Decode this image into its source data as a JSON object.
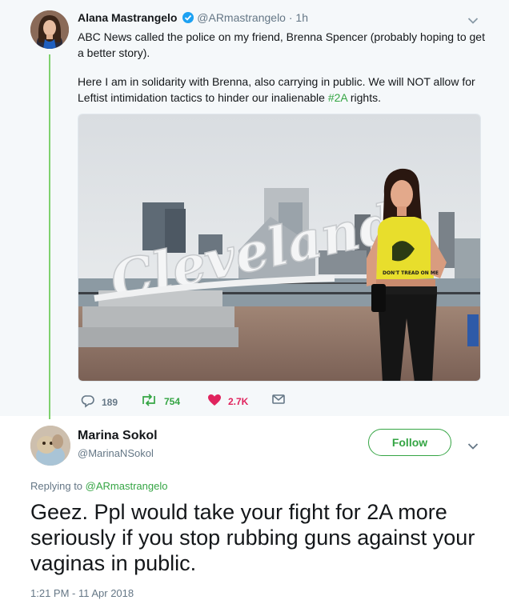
{
  "original_tweet": {
    "name": "Alana Mastrangelo",
    "handle": "@ARmastrangelo",
    "separator": "·",
    "time": "1h",
    "paragraph1": "ABC News called the police on my friend, Brenna Spencer (probably hoping to get a better story).",
    "paragraph2_before": "Here I am in solidarity with Brenna, also carrying in public. We will NOT allow for Leftist intimidation tactics to hinder our inalienable ",
    "hashtag": "#2A",
    "paragraph2_after": " rights.",
    "photo": {
      "sign_text": "Cleveland",
      "shirt_text": "DON'T TREAD ON ME"
    },
    "actions": {
      "replies": "189",
      "retweets": "754",
      "likes": "2.7K"
    }
  },
  "reply": {
    "name": "Marina Sokol",
    "handle": "@MarinaNSokol",
    "follow_label": "Follow",
    "replying_prefix": "Replying to",
    "replying_mention": "@ARmastrangelo",
    "text": "Geez. Ppl would take your fight for 2A more seriously if you stop rubbing guns against your vaginas in public.",
    "timestamp": "1:21 PM - 11 Apr 2018"
  },
  "colors": {
    "accent": "#35a544",
    "thread_line": "#7fd16f",
    "like_red": "#e0245e",
    "verified_blue": "#1da1f2",
    "muted": "#657786"
  },
  "icons": [
    "verified-badge-icon",
    "chevron-down-icon",
    "reply-icon",
    "retweet-icon",
    "heart-icon",
    "direct-message-icon"
  ]
}
